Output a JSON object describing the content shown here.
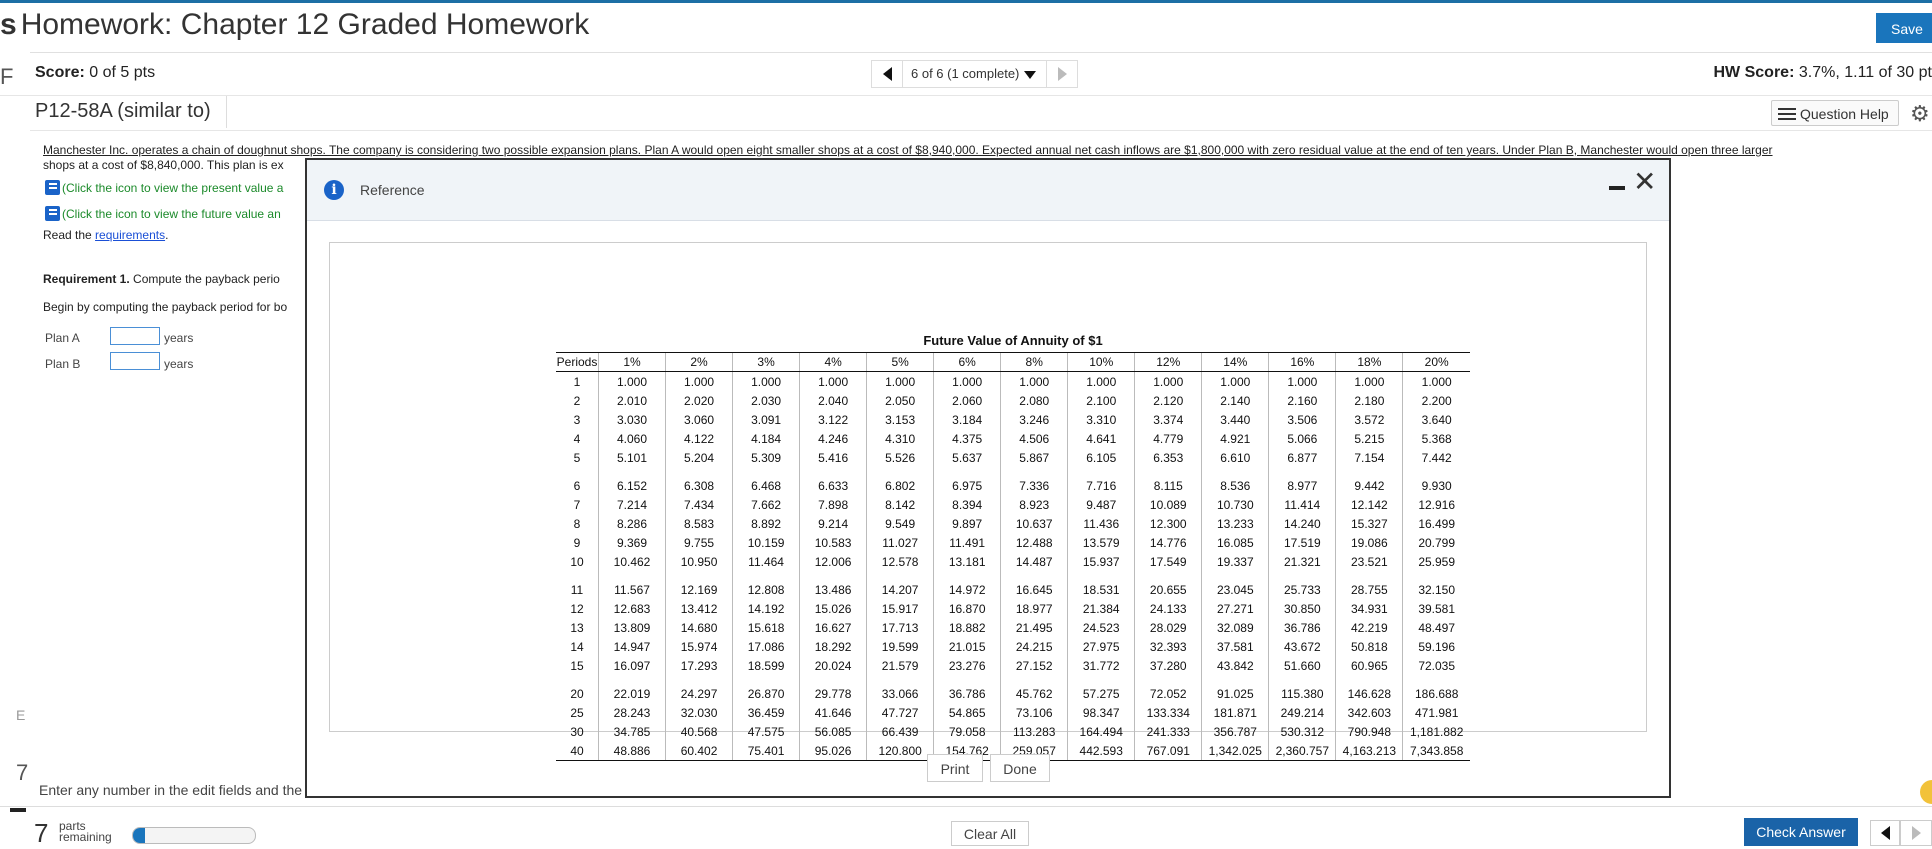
{
  "page": {
    "title": "Homework: Chapter 12 Graded Homework",
    "title_prefix": "s",
    "save_label": "Save",
    "left_edge_letter": "F",
    "score_label": "Score:",
    "score_value": "0 of 5 pts",
    "question_nav": "6 of 6 (1 complete)",
    "hw_score_label": "HW Score:",
    "hw_score_value": "3.7%, 1.11 of 30 pt",
    "problem_id": "P12-58A (similar to)",
    "question_help_label": "Question Help"
  },
  "problem": {
    "intro_line1": "Manchester Inc. operates a chain of doughnut shops. The company is considering two possible expansion plans. Plan A would open eight smaller shops at a cost of $8,940,000. Expected annual net cash inflows are $1,800,000 with zero residual value at the end of ten years. Under Plan B, Manchester would open three larger",
    "intro_line2": "shops at a cost of $8,840,000. This plan is ex",
    "pv_link": "(Click the icon to view the present value a",
    "fv_link": "(Click the icon to view the future value an",
    "read_prefix": "Read the ",
    "requirements_link": "requirements",
    "read_suffix": ".",
    "req1_bold": "Requirement 1.",
    "req1_text": " Compute the payback perio",
    "begin_text": "Begin by computing the payback period for bo",
    "plans": [
      {
        "label": "Plan A",
        "value": "",
        "unit": "years"
      },
      {
        "label": "Plan B",
        "value": "",
        "unit": "years"
      }
    ],
    "enter_any": "Enter any number in the edit fields and the"
  },
  "footer": {
    "parts_count": "7",
    "parts_label_1": "parts",
    "parts_label_2": "remaining",
    "progress_fraction": 0.1,
    "clear_all_label": "Clear All",
    "check_answer_label": "Check Answer",
    "side_letter_e": "E",
    "side_number": "7"
  },
  "dialog": {
    "title": "Reference",
    "print_label": "Print",
    "done_label": "Done"
  },
  "chart_data": {
    "type": "table",
    "title": "Future Value of Annuity of $1",
    "columns": [
      "Periods",
      "1%",
      "2%",
      "3%",
      "4%",
      "5%",
      "6%",
      "8%",
      "10%",
      "12%",
      "14%",
      "16%",
      "18%",
      "20%"
    ],
    "rows": [
      [
        "1",
        "1.000",
        "1.000",
        "1.000",
        "1.000",
        "1.000",
        "1.000",
        "1.000",
        "1.000",
        "1.000",
        "1.000",
        "1.000",
        "1.000",
        "1.000"
      ],
      [
        "2",
        "2.010",
        "2.020",
        "2.030",
        "2.040",
        "2.050",
        "2.060",
        "2.080",
        "2.100",
        "2.120",
        "2.140",
        "2.160",
        "2.180",
        "2.200"
      ],
      [
        "3",
        "3.030",
        "3.060",
        "3.091",
        "3.122",
        "3.153",
        "3.184",
        "3.246",
        "3.310",
        "3.374",
        "3.440",
        "3.506",
        "3.572",
        "3.640"
      ],
      [
        "4",
        "4.060",
        "4.122",
        "4.184",
        "4.246",
        "4.310",
        "4.375",
        "4.506",
        "4.641",
        "4.779",
        "4.921",
        "5.066",
        "5.215",
        "5.368"
      ],
      [
        "5",
        "5.101",
        "5.204",
        "5.309",
        "5.416",
        "5.526",
        "5.637",
        "5.867",
        "6.105",
        "6.353",
        "6.610",
        "6.877",
        "7.154",
        "7.442"
      ],
      [
        "6",
        "6.152",
        "6.308",
        "6.468",
        "6.633",
        "6.802",
        "6.975",
        "7.336",
        "7.716",
        "8.115",
        "8.536",
        "8.977",
        "9.442",
        "9.930"
      ],
      [
        "7",
        "7.214",
        "7.434",
        "7.662",
        "7.898",
        "8.142",
        "8.394",
        "8.923",
        "9.487",
        "10.089",
        "10.730",
        "11.414",
        "12.142",
        "12.916"
      ],
      [
        "8",
        "8.286",
        "8.583",
        "8.892",
        "9.214",
        "9.549",
        "9.897",
        "10.637",
        "11.436",
        "12.300",
        "13.233",
        "14.240",
        "15.327",
        "16.499"
      ],
      [
        "9",
        "9.369",
        "9.755",
        "10.159",
        "10.583",
        "11.027",
        "11.491",
        "12.488",
        "13.579",
        "14.776",
        "16.085",
        "17.519",
        "19.086",
        "20.799"
      ],
      [
        "10",
        "10.462",
        "10.950",
        "11.464",
        "12.006",
        "12.578",
        "13.181",
        "14.487",
        "15.937",
        "17.549",
        "19.337",
        "21.321",
        "23.521",
        "25.959"
      ],
      [
        "11",
        "11.567",
        "12.169",
        "12.808",
        "13.486",
        "14.207",
        "14.972",
        "16.645",
        "18.531",
        "20.655",
        "23.045",
        "25.733",
        "28.755",
        "32.150"
      ],
      [
        "12",
        "12.683",
        "13.412",
        "14.192",
        "15.026",
        "15.917",
        "16.870",
        "18.977",
        "21.384",
        "24.133",
        "27.271",
        "30.850",
        "34.931",
        "39.581"
      ],
      [
        "13",
        "13.809",
        "14.680",
        "15.618",
        "16.627",
        "17.713",
        "18.882",
        "21.495",
        "24.523",
        "28.029",
        "32.089",
        "36.786",
        "42.219",
        "48.497"
      ],
      [
        "14",
        "14.947",
        "15.974",
        "17.086",
        "18.292",
        "19.599",
        "21.015",
        "24.215",
        "27.975",
        "32.393",
        "37.581",
        "43.672",
        "50.818",
        "59.196"
      ],
      [
        "15",
        "16.097",
        "17.293",
        "18.599",
        "20.024",
        "21.579",
        "23.276",
        "27.152",
        "31.772",
        "37.280",
        "43.842",
        "51.660",
        "60.965",
        "72.035"
      ],
      [
        "20",
        "22.019",
        "24.297",
        "26.870",
        "29.778",
        "33.066",
        "36.786",
        "45.762",
        "57.275",
        "72.052",
        "91.025",
        "115.380",
        "146.628",
        "186.688"
      ],
      [
        "25",
        "28.243",
        "32.030",
        "36.459",
        "41.646",
        "47.727",
        "54.865",
        "73.106",
        "98.347",
        "133.334",
        "181.871",
        "249.214",
        "342.603",
        "471.981"
      ],
      [
        "30",
        "34.785",
        "40.568",
        "47.575",
        "56.085",
        "66.439",
        "79.058",
        "113.283",
        "164.494",
        "241.333",
        "356.787",
        "530.312",
        "790.948",
        "1,181.882"
      ],
      [
        "40",
        "48.886",
        "60.402",
        "75.401",
        "95.026",
        "120.800",
        "154.762",
        "259.057",
        "442.593",
        "767.091",
        "1,342.025",
        "2,360.757",
        "4,163.213",
        "7,343.858"
      ]
    ],
    "row_groups": [
      [
        0,
        4
      ],
      [
        5,
        9
      ],
      [
        10,
        14
      ],
      [
        15,
        18
      ]
    ]
  }
}
